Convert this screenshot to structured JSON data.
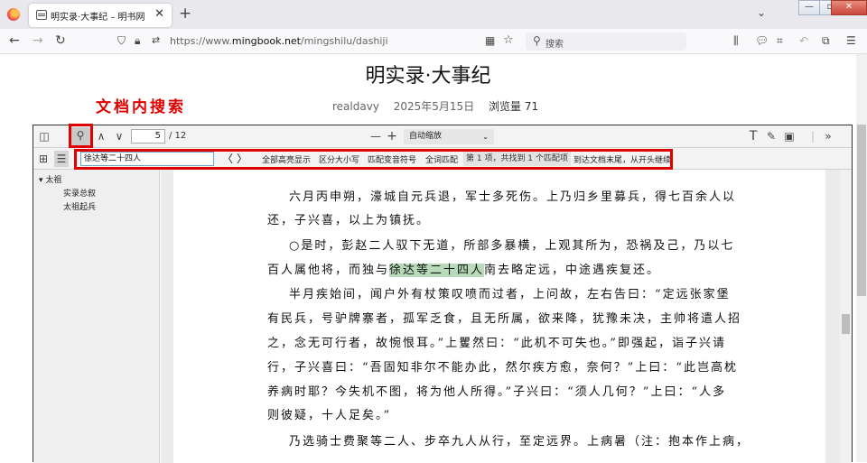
{
  "browser": {
    "tab_title": "明实录·大事纪 – 明书网",
    "tab_close": "✕",
    "new_tab": "+",
    "url_prefix": "https://www.",
    "url_domain": "mingbook.net",
    "url_path": "/mingshilu/dashiji",
    "search_placeholder": "搜索"
  },
  "page": {
    "title": "明实录·大事纪",
    "annotation": "文档内搜索",
    "author": "realdavy",
    "date": "2025年5月15日",
    "views": "浏览量 71"
  },
  "toolbar": {
    "page_value": "5",
    "page_count": "/ 12",
    "zoom_minus": "—",
    "zoom_plus": "+",
    "zoom_select": "自动缩放"
  },
  "findbar": {
    "query": "徐达等二十四人",
    "highlight_all": "全部高亮显示",
    "match_case": "区分大小写",
    "match_diacritics": "匹配变音符号",
    "whole_words": "全词匹配",
    "result": "第 1 项，共找到 1 个匹配项",
    "wrapped": "到达文档末尾，从开头继续"
  },
  "outline": {
    "root": "太祖",
    "items": [
      "实录总叙",
      "太祖起兵"
    ]
  },
  "document": {
    "lines": [
      "六月丙申朔，濠城自元兵退，军士多死伤。上乃归乡里募兵，得七百余人以",
      "还，子兴喜，以上为镇抚。",
      "○是时，彭赵二人驭下无道，所部多暴横，上观其所为，恐祸及己，乃以七",
      "百人属他将，而独与",
      "徐达等二十四人",
      "南去略定远，中途遇疾复还。",
      "半月疾始间，闻户外有杖策叹喷而过者，上问故，左右告曰：“定远张家堡",
      "有民兵，号驴牌寨者，孤军乏食，且无所属，欲来降，犹豫未决，主帅将遣人招",
      "之，念无可行者，故惋恨耳。”上矍然曰：“此机不可失也。”即强起，诣子兴请",
      "行，子兴喜曰：“吾固知非尔不能办此，然尔疾方愈，奈何？”上曰：“此岂高枕",
      "养病时耶？今失机不图，将为他人所得。”子兴曰：“须人几何？”上曰：“人多",
      "则彼疑，十人足矣。”",
      "乃选骑士费聚等二人、步卒九人从行，至定远界。上病暑（注：抱本作上病，"
    ]
  },
  "colors": {
    "annotation_red": "#e00000",
    "highlight_green": "#b9dab9"
  }
}
